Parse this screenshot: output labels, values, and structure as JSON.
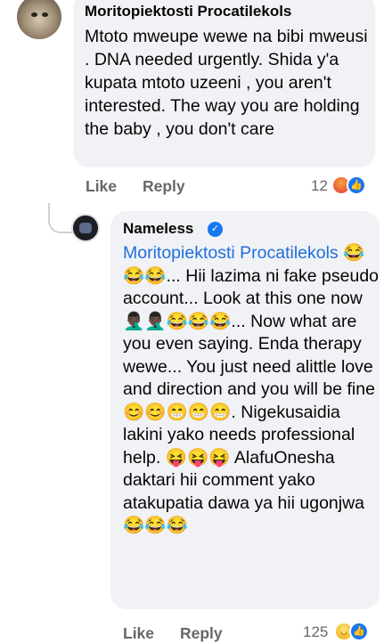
{
  "comment": {
    "author": "Moritopiektosti Procatilekols",
    "text": "Mtoto mweupe wewe na bibi mweusi . DNA needed urgently. Shida y'a kupata mtoto uzeeni , you aren't interested. The way you are holding the baby , you don't care",
    "like_label": "Like",
    "reply_label": "Reply",
    "reaction_count": "12",
    "reactions": [
      "angry-icon",
      "like-icon"
    ]
  },
  "reply": {
    "author": "Nameless",
    "verified": true,
    "mention": "Moritopiektosti Procatilekols",
    "text": " 😂😂😂...  Hii lazima ni fake pseudo account... Look at this one now 🤦🏿‍♂️🤦🏿‍♂️😂😂😂... Now what are you even saying. Enda therapy wewe... You just need alittle love and direction and you will be fine 😊😊😁😁😁. Nigekusaidia lakini yako needs professional help. 😝😝😝 AlafuOnesha daktari hii comment yako atakupatia dawa ya hii ugonjwa 😂😂😂",
    "like_label": "Like",
    "reply_label": "Reply",
    "reaction_count": "125",
    "reactions": [
      "laugh-icon",
      "like-icon"
    ]
  },
  "colors": {
    "bubble": "#f0f2f5",
    "mention": "#216fdb",
    "action_text": "#65676b",
    "like_blue": "#1877f2"
  }
}
